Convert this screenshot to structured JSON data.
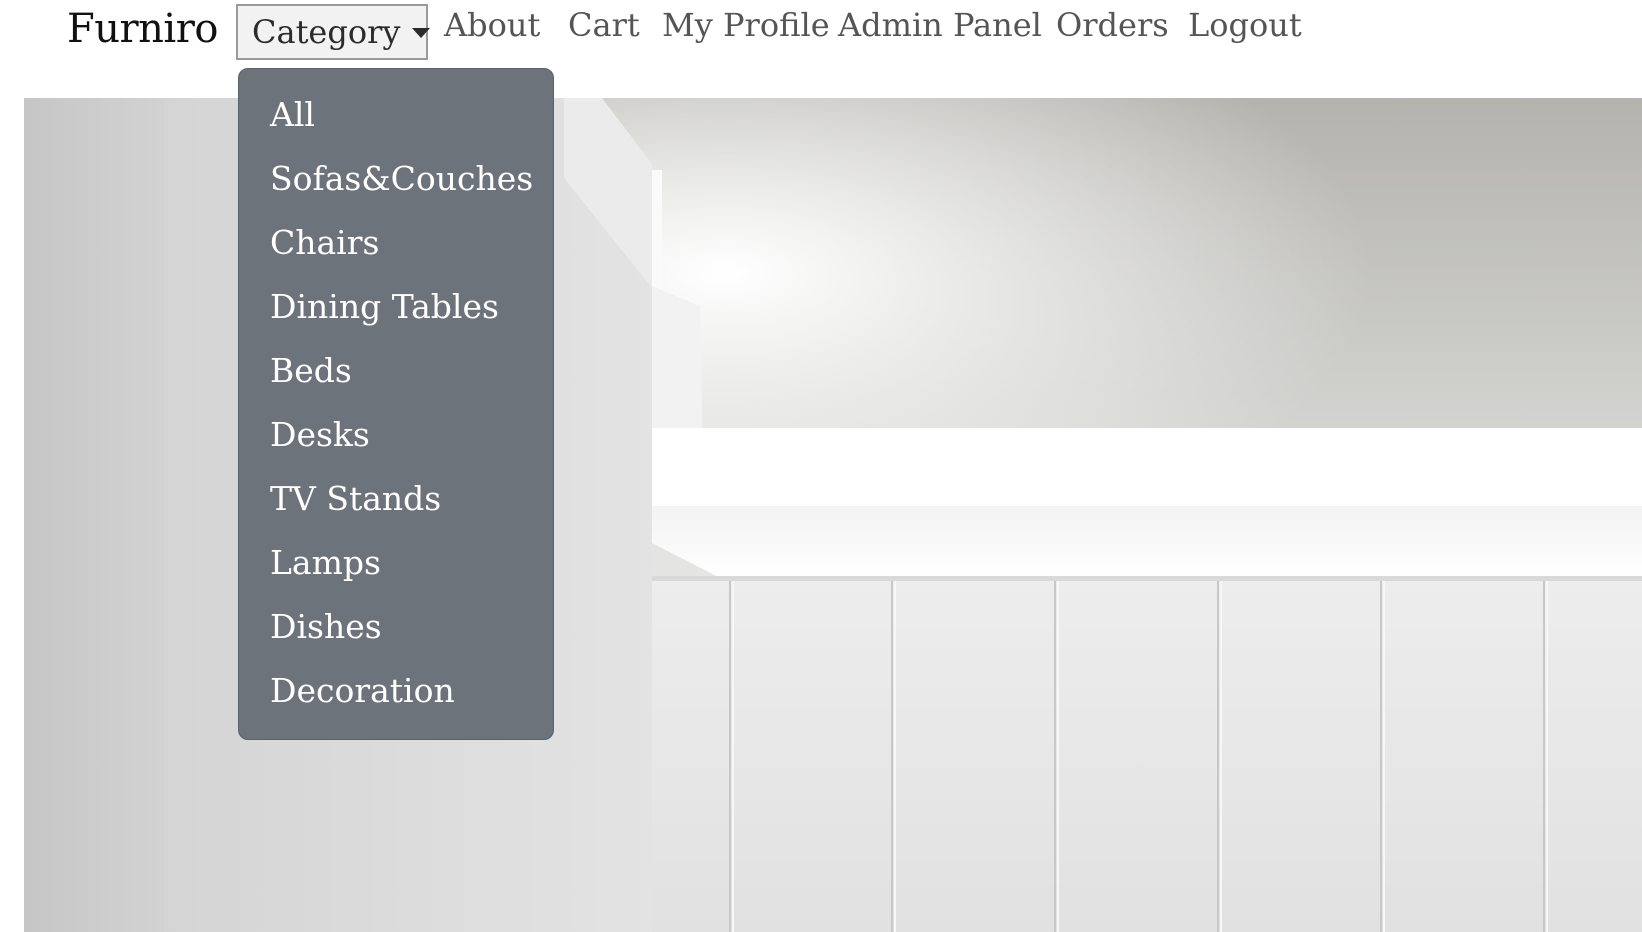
{
  "navbar": {
    "brand": "Furniro",
    "category_label": "Category",
    "links": [
      "About",
      "Cart",
      "My Profile",
      "Admin Panel",
      "Orders",
      "Logout"
    ]
  },
  "dropdown": {
    "items": [
      "All",
      "Sofas&Couches",
      "Chairs",
      "Dining Tables",
      "Beds",
      "Desks",
      "TV Stands",
      "Lamps",
      "Dishes",
      "Decoration"
    ]
  },
  "hero": {
    "image": "white interior wall with wooden panels and ceiling light"
  },
  "colors": {
    "dropdown_bg": "#6d737b",
    "nav_link": "#555555",
    "brand": "#111111"
  }
}
